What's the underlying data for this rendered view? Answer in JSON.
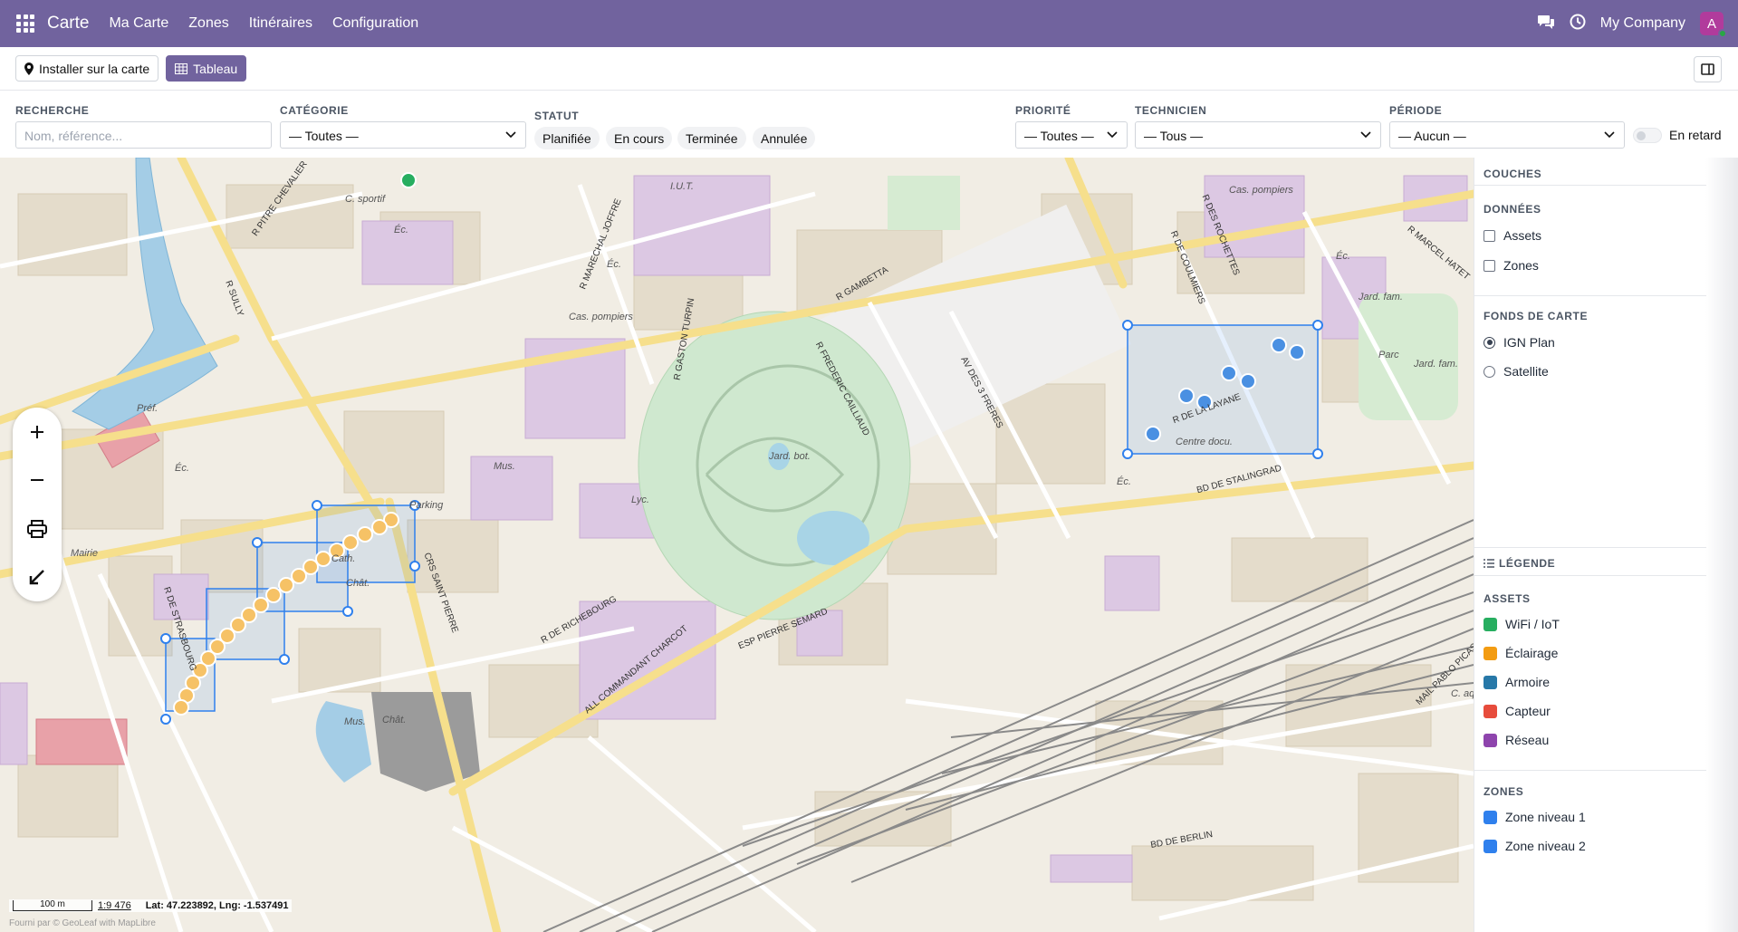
{
  "navbar": {
    "app_title": "Carte",
    "menu": [
      "Ma Carte",
      "Zones",
      "Itinéraires",
      "Configuration"
    ],
    "company": "My Company",
    "avatar_letter": "A"
  },
  "toolbar": {
    "install_label": "Installer sur la carte",
    "table_label": "Tableau"
  },
  "filters": {
    "search": {
      "label": "RECHERCHE",
      "placeholder": "Nom, référence..."
    },
    "category": {
      "label": "CATÉGORIE",
      "value": "— Toutes —"
    },
    "status": {
      "label": "STATUT",
      "options": [
        "Planifiée",
        "En cours",
        "Terminée",
        "Annulée"
      ]
    },
    "priority": {
      "label": "PRIORITÉ",
      "value": "— Toutes —"
    },
    "technician": {
      "label": "TECHNICIEN",
      "value": "— Tous —"
    },
    "period": {
      "label": "PÉRIODE",
      "value": "— Aucun —"
    },
    "late_label": "En retard"
  },
  "map": {
    "scale_label": "100 m",
    "scale_ratio": "1:9 476",
    "coords": "Lat: 47.223892, Lng: -1.537491",
    "attribution": "Fourni par © GeoLeaf with MapLibre",
    "place_labels": [
      "C. sportif",
      "Éc.",
      "I.U.T.",
      "Éc.",
      "Cas. pompiers",
      "Préf.",
      "Éc.",
      "Mus.",
      "Lyc.",
      "Mairie",
      "Cath.",
      "Chât.",
      "Jard. bot.",
      "Centre docu.",
      "Éc.",
      "Cas. pompiers",
      "Éc.",
      "Jard. fam.",
      "Parc",
      "Jard. fam.",
      "Chât.",
      "Mus.",
      "Parking",
      "C. aqu."
    ],
    "street_labels": [
      "R PITRE CHEVALIER",
      "R SULLY",
      "R GAMBETTA",
      "R FREDERIC CAILLIAUD",
      "AV DES 3 FRERES",
      "BD DE STALINGRAD",
      "BD DE BERLIN",
      "R DE COULMIERS",
      "R DES ROCHETTES",
      "R DE LA LAYANE",
      "CRS SAINT PIERRE",
      "R DE STRASBOURG",
      "ESP PIERRE SEMARD",
      "ALL COMMANDANT CHARCOT",
      "R MARECHAL JOFFRE",
      "R GASTON TURPIN",
      "MAIL PABLO PICASSO",
      "R DE RICHEBOURG",
      "R MARCEL HATET"
    ]
  },
  "panel": {
    "layers_title": "COUCHES",
    "data_title": "DONNÉES",
    "data_items": [
      "Assets",
      "Zones"
    ],
    "basemap_title": "FONDS DE CARTE",
    "basemaps": [
      "IGN Plan",
      "Satellite"
    ],
    "basemap_selected": "IGN Plan",
    "legend_title": "LÉGENDE",
    "assets_title": "ASSETS",
    "asset_legend": [
      {
        "label": "WiFi / IoT",
        "color": "#27ae60"
      },
      {
        "label": "Éclairage",
        "color": "#f39c12"
      },
      {
        "label": "Armoire",
        "color": "#2778a8"
      },
      {
        "label": "Capteur",
        "color": "#e74c3c"
      },
      {
        "label": "Réseau",
        "color": "#8e44ad"
      }
    ],
    "zones_title": "ZONES",
    "zone_legend": [
      {
        "label": "Zone niveau 1",
        "color": "#2f80ed"
      },
      {
        "label": "Zone niveau 2",
        "color": "#2f80ed"
      }
    ]
  }
}
